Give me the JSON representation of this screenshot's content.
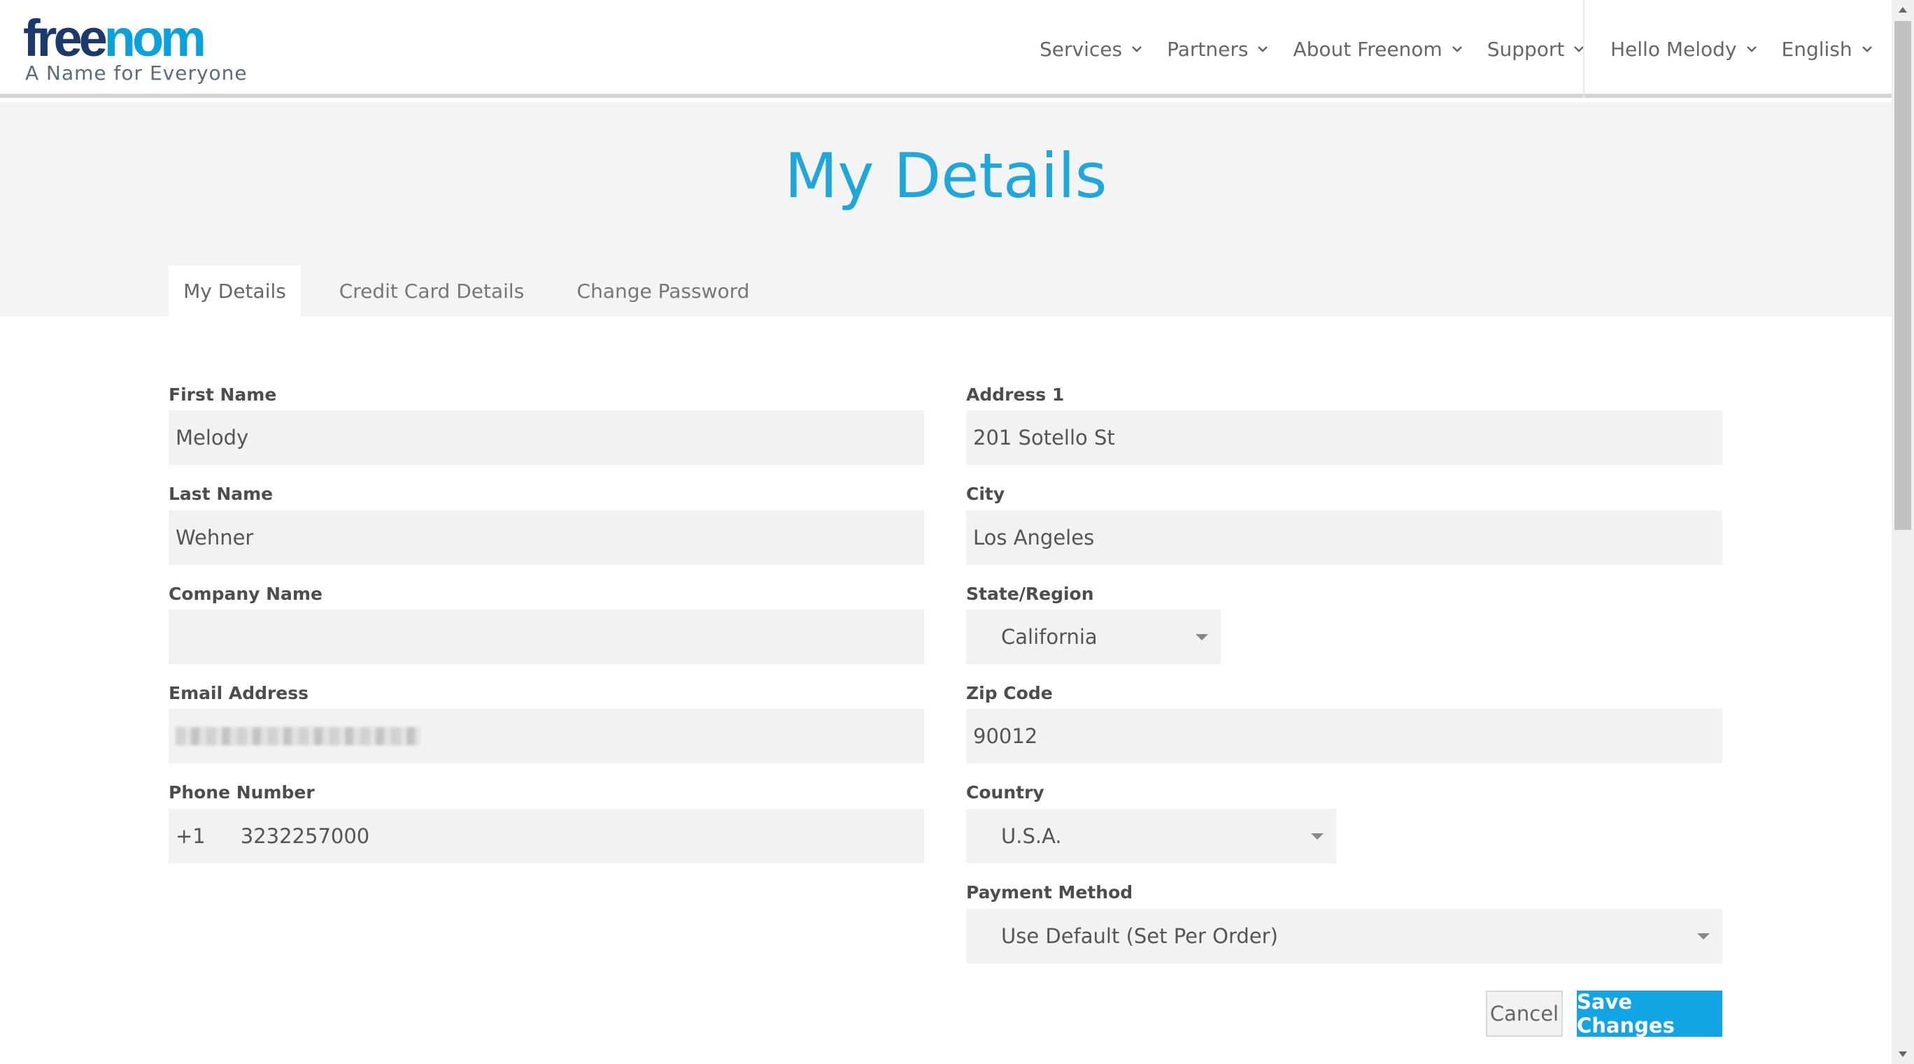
{
  "header": {
    "logo_part1": "free",
    "logo_part2": "nom",
    "tagline": "A Name for Everyone",
    "nav": [
      {
        "label": "Services"
      },
      {
        "label": "Partners"
      },
      {
        "label": "About Freenom"
      },
      {
        "label": "Support"
      }
    ],
    "user_menu": "Hello Melody",
    "language": "English"
  },
  "page": {
    "title": "My Details",
    "tabs": [
      {
        "label": "My Details",
        "active": true
      },
      {
        "label": "Credit Card Details",
        "active": false
      },
      {
        "label": "Change Password",
        "active": false
      }
    ]
  },
  "form": {
    "first_name": {
      "label": "First Name",
      "value": "Melody"
    },
    "last_name": {
      "label": "Last Name",
      "value": "Wehner"
    },
    "company_name": {
      "label": "Company Name",
      "value": ""
    },
    "email": {
      "label": "Email Address",
      "value": ""
    },
    "phone": {
      "label": "Phone Number",
      "prefix": "+1",
      "value": "3232257000"
    },
    "address1": {
      "label": "Address 1",
      "value": "201 Sotello St"
    },
    "city": {
      "label": "City",
      "value": "Los Angeles"
    },
    "state": {
      "label": "State/Region",
      "value": "California"
    },
    "zip": {
      "label": "Zip Code",
      "value": "90012"
    },
    "country": {
      "label": "Country",
      "value": "U.S.A."
    },
    "payment_method": {
      "label": "Payment Method",
      "value": "Use Default (Set Per Order)"
    }
  },
  "actions": {
    "cancel": "Cancel",
    "save": "Save Changes"
  },
  "colors": {
    "accent": "#1ea7dc",
    "save_button": "#12a5e6",
    "logo_dark": "#1b3a6b",
    "band": "#f4f4f4",
    "field_bg": "#f2f2f2"
  }
}
